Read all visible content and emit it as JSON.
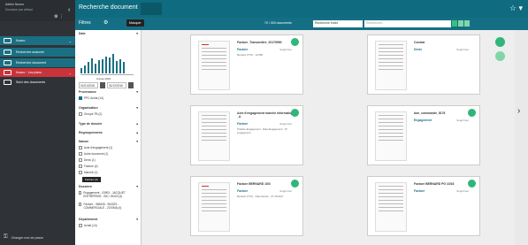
{
  "sidebar": {
    "user_name": "Admin Nuxeo",
    "user_sub": "Domaine par défaut",
    "items": [
      {
        "label": "Nuxeo",
        "color": "#1b6f82"
      },
      {
        "label": "Recherche avancée",
        "color": "#1b6f82"
      },
      {
        "label": "Recherche document",
        "color": "#1b6f82"
      },
      {
        "label": "Nuxeo · Les plans",
        "color": "#c7343a"
      },
      {
        "label": "Suivi des documents",
        "color": "#2f3338"
      }
    ],
    "bottom_label": "Changer mot de passe"
  },
  "topbar": {
    "title": "Recherche document",
    "tab_label": ""
  },
  "toolbar": {
    "filters_label": "Filtres",
    "tooltip": "Masquer",
    "count": "70 / 300 documents",
    "sort_select": "Recherche index",
    "search_placeholder": "Rechercher..."
  },
  "filters": {
    "date_title": "Date",
    "date_axis": "Année 2016",
    "date_from": "01/01/2016",
    "date_to": "31/12/2016",
    "bars": [
      20,
      30,
      40,
      55,
      35,
      48,
      52,
      62,
      58,
      70,
      45,
      50,
      40
    ],
    "provenance_title": "Provenance",
    "provenance": [
      {
        "label": "PPC Achat (14)",
        "checked": true
      }
    ],
    "organisation_title": "Organisation",
    "organisation": [
      {
        "label": "Groupe TB (2)",
        "checked": false
      }
    ],
    "type_dossier_title": "Type de dossier",
    "regroupements_title": "Regroupements",
    "nature_title": "Nature",
    "nature": [
      {
        "label": "Acte d'engagement (1)",
        "checked": false
      },
      {
        "label": "Autre document (1)",
        "checked": false
      },
      {
        "label": "Devis (1)",
        "checked": false
      },
      {
        "label": "Facture (4)",
        "checked": false
      },
      {
        "label": "Marché (1)",
        "checked": false
      }
    ],
    "tooltip2": "Facture (4)",
    "dossiers_title": "Dossiers",
    "dossiers": [
      {
        "label": "Engagement - 03903 - JACQUET ENTREPRISE - BIC: 00403 (4)",
        "checked": false
      },
      {
        "label": "Facture - 966345 - 964323 - COMMERCIALE - ZOOMA (4)",
        "checked": false
      }
    ],
    "departement_title": "Département",
    "departement": [
      {
        "label": "Achat (14)",
        "checked": false
      }
    ]
  },
  "results": {
    "cards": [
      {
        "title": "Facture_Transmettre_20179990",
        "type": "Facture",
        "status": "Supprimer",
        "details": "Montant (TTC) : 10 650",
        "red": true
      },
      {
        "title": "Contrat",
        "type": "Devis",
        "status": "Supprimer",
        "details": "",
        "red": false
      },
      {
        "title": "Acte d'engagement marché informatique _A",
        "type": "Facture",
        "status": "Supprimer",
        "details": "Titulaire Engagement · Date Engagement · N° engagement",
        "red": false
      },
      {
        "title": "bon_commande_8176",
        "type": "Engagement",
        "status": "Supprimer",
        "details": "",
        "red": false
      },
      {
        "title": "Facture BERNARD 10/3",
        "type": "Facture",
        "status": "Supprimer",
        "details": "Montant (TTC) · Date facture · 07.15.2017",
        "red": true
      },
      {
        "title": "Facture BERNARD PG 10/16",
        "type": "Facture",
        "status": "Supprimer",
        "details": "",
        "red": false
      }
    ]
  }
}
